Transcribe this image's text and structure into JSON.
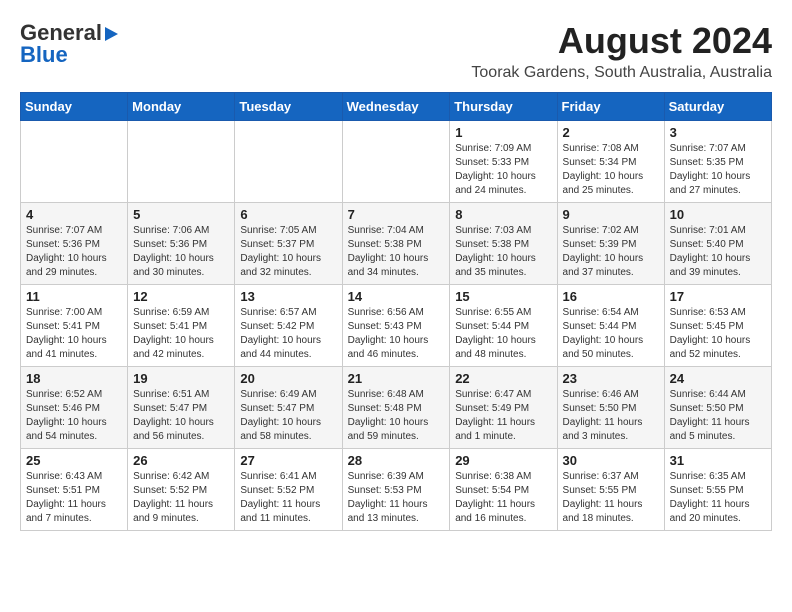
{
  "header": {
    "logo_line1": "General",
    "logo_line2": "Blue",
    "title": "August 2024",
    "subtitle": "Toorak Gardens, South Australia, Australia"
  },
  "weekdays": [
    "Sunday",
    "Monday",
    "Tuesday",
    "Wednesday",
    "Thursday",
    "Friday",
    "Saturday"
  ],
  "weeks": [
    [
      {
        "day": "",
        "sunrise": "",
        "sunset": "",
        "daylight": ""
      },
      {
        "day": "",
        "sunrise": "",
        "sunset": "",
        "daylight": ""
      },
      {
        "day": "",
        "sunrise": "",
        "sunset": "",
        "daylight": ""
      },
      {
        "day": "",
        "sunrise": "",
        "sunset": "",
        "daylight": ""
      },
      {
        "day": "1",
        "sunrise": "Sunrise: 7:09 AM",
        "sunset": "Sunset: 5:33 PM",
        "daylight": "Daylight: 10 hours and 24 minutes."
      },
      {
        "day": "2",
        "sunrise": "Sunrise: 7:08 AM",
        "sunset": "Sunset: 5:34 PM",
        "daylight": "Daylight: 10 hours and 25 minutes."
      },
      {
        "day": "3",
        "sunrise": "Sunrise: 7:07 AM",
        "sunset": "Sunset: 5:35 PM",
        "daylight": "Daylight: 10 hours and 27 minutes."
      }
    ],
    [
      {
        "day": "4",
        "sunrise": "Sunrise: 7:07 AM",
        "sunset": "Sunset: 5:36 PM",
        "daylight": "Daylight: 10 hours and 29 minutes."
      },
      {
        "day": "5",
        "sunrise": "Sunrise: 7:06 AM",
        "sunset": "Sunset: 5:36 PM",
        "daylight": "Daylight: 10 hours and 30 minutes."
      },
      {
        "day": "6",
        "sunrise": "Sunrise: 7:05 AM",
        "sunset": "Sunset: 5:37 PM",
        "daylight": "Daylight: 10 hours and 32 minutes."
      },
      {
        "day": "7",
        "sunrise": "Sunrise: 7:04 AM",
        "sunset": "Sunset: 5:38 PM",
        "daylight": "Daylight: 10 hours and 34 minutes."
      },
      {
        "day": "8",
        "sunrise": "Sunrise: 7:03 AM",
        "sunset": "Sunset: 5:38 PM",
        "daylight": "Daylight: 10 hours and 35 minutes."
      },
      {
        "day": "9",
        "sunrise": "Sunrise: 7:02 AM",
        "sunset": "Sunset: 5:39 PM",
        "daylight": "Daylight: 10 hours and 37 minutes."
      },
      {
        "day": "10",
        "sunrise": "Sunrise: 7:01 AM",
        "sunset": "Sunset: 5:40 PM",
        "daylight": "Daylight: 10 hours and 39 minutes."
      }
    ],
    [
      {
        "day": "11",
        "sunrise": "Sunrise: 7:00 AM",
        "sunset": "Sunset: 5:41 PM",
        "daylight": "Daylight: 10 hours and 41 minutes."
      },
      {
        "day": "12",
        "sunrise": "Sunrise: 6:59 AM",
        "sunset": "Sunset: 5:41 PM",
        "daylight": "Daylight: 10 hours and 42 minutes."
      },
      {
        "day": "13",
        "sunrise": "Sunrise: 6:57 AM",
        "sunset": "Sunset: 5:42 PM",
        "daylight": "Daylight: 10 hours and 44 minutes."
      },
      {
        "day": "14",
        "sunrise": "Sunrise: 6:56 AM",
        "sunset": "Sunset: 5:43 PM",
        "daylight": "Daylight: 10 hours and 46 minutes."
      },
      {
        "day": "15",
        "sunrise": "Sunrise: 6:55 AM",
        "sunset": "Sunset: 5:44 PM",
        "daylight": "Daylight: 10 hours and 48 minutes."
      },
      {
        "day": "16",
        "sunrise": "Sunrise: 6:54 AM",
        "sunset": "Sunset: 5:44 PM",
        "daylight": "Daylight: 10 hours and 50 minutes."
      },
      {
        "day": "17",
        "sunrise": "Sunrise: 6:53 AM",
        "sunset": "Sunset: 5:45 PM",
        "daylight": "Daylight: 10 hours and 52 minutes."
      }
    ],
    [
      {
        "day": "18",
        "sunrise": "Sunrise: 6:52 AM",
        "sunset": "Sunset: 5:46 PM",
        "daylight": "Daylight: 10 hours and 54 minutes."
      },
      {
        "day": "19",
        "sunrise": "Sunrise: 6:51 AM",
        "sunset": "Sunset: 5:47 PM",
        "daylight": "Daylight: 10 hours and 56 minutes."
      },
      {
        "day": "20",
        "sunrise": "Sunrise: 6:49 AM",
        "sunset": "Sunset: 5:47 PM",
        "daylight": "Daylight: 10 hours and 58 minutes."
      },
      {
        "day": "21",
        "sunrise": "Sunrise: 6:48 AM",
        "sunset": "Sunset: 5:48 PM",
        "daylight": "Daylight: 10 hours and 59 minutes."
      },
      {
        "day": "22",
        "sunrise": "Sunrise: 6:47 AM",
        "sunset": "Sunset: 5:49 PM",
        "daylight": "Daylight: 11 hours and 1 minute."
      },
      {
        "day": "23",
        "sunrise": "Sunrise: 6:46 AM",
        "sunset": "Sunset: 5:50 PM",
        "daylight": "Daylight: 11 hours and 3 minutes."
      },
      {
        "day": "24",
        "sunrise": "Sunrise: 6:44 AM",
        "sunset": "Sunset: 5:50 PM",
        "daylight": "Daylight: 11 hours and 5 minutes."
      }
    ],
    [
      {
        "day": "25",
        "sunrise": "Sunrise: 6:43 AM",
        "sunset": "Sunset: 5:51 PM",
        "daylight": "Daylight: 11 hours and 7 minutes."
      },
      {
        "day": "26",
        "sunrise": "Sunrise: 6:42 AM",
        "sunset": "Sunset: 5:52 PM",
        "daylight": "Daylight: 11 hours and 9 minutes."
      },
      {
        "day": "27",
        "sunrise": "Sunrise: 6:41 AM",
        "sunset": "Sunset: 5:52 PM",
        "daylight": "Daylight: 11 hours and 11 minutes."
      },
      {
        "day": "28",
        "sunrise": "Sunrise: 6:39 AM",
        "sunset": "Sunset: 5:53 PM",
        "daylight": "Daylight: 11 hours and 13 minutes."
      },
      {
        "day": "29",
        "sunrise": "Sunrise: 6:38 AM",
        "sunset": "Sunset: 5:54 PM",
        "daylight": "Daylight: 11 hours and 16 minutes."
      },
      {
        "day": "30",
        "sunrise": "Sunrise: 6:37 AM",
        "sunset": "Sunset: 5:55 PM",
        "daylight": "Daylight: 11 hours and 18 minutes."
      },
      {
        "day": "31",
        "sunrise": "Sunrise: 6:35 AM",
        "sunset": "Sunset: 5:55 PM",
        "daylight": "Daylight: 11 hours and 20 minutes."
      }
    ]
  ]
}
